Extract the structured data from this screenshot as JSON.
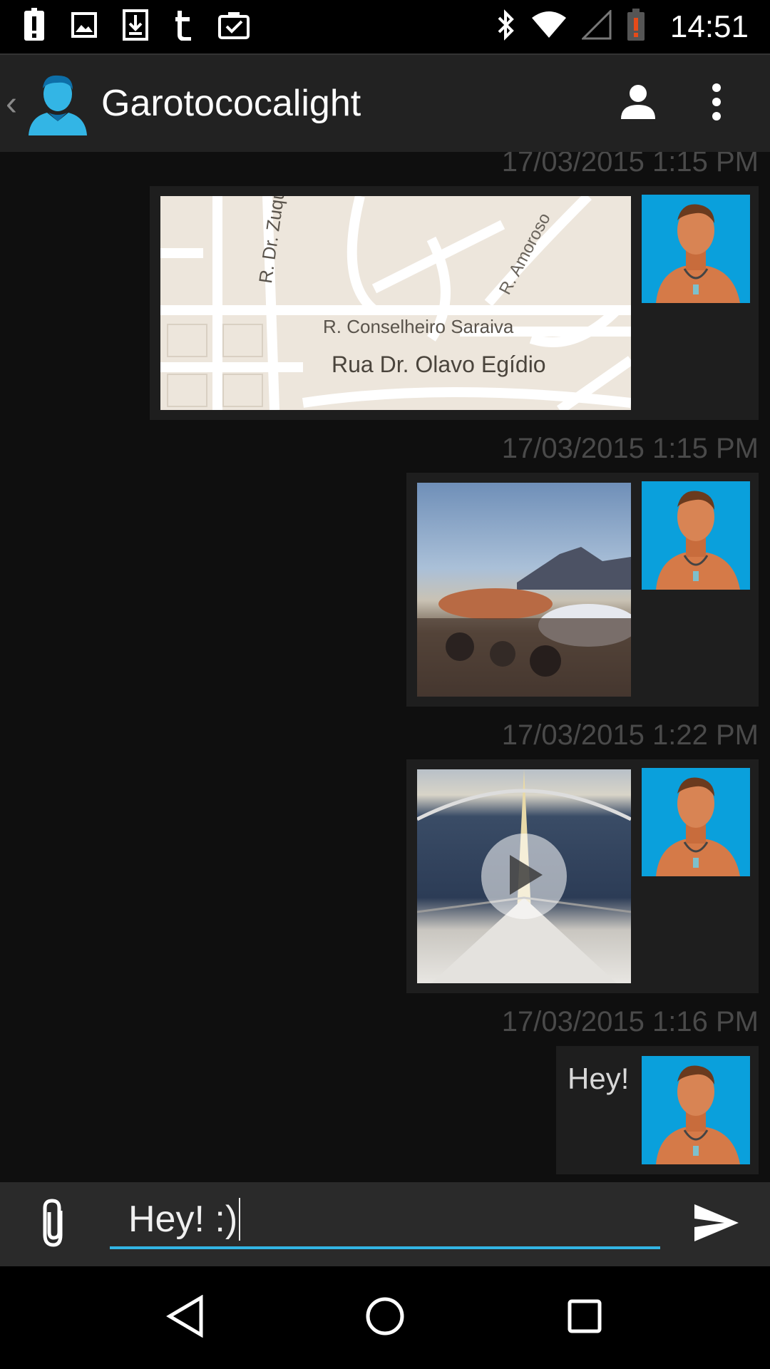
{
  "status_bar": {
    "time": "14:51",
    "left_icons": [
      "alert-icon",
      "image-icon",
      "download-icon",
      "tumblr-icon",
      "clipboard-check-icon"
    ],
    "right_icons": [
      "bluetooth-icon",
      "wifi-icon",
      "cell-signal-icon",
      "battery-alert-icon"
    ]
  },
  "app_bar": {
    "back_symbol": "‹",
    "contact_name": "Garotococalight",
    "actions": [
      "person-icon",
      "overflow-menu-icon"
    ]
  },
  "messages": [
    {
      "timestamp": "17/03/2015 1:15 PM",
      "type": "map",
      "map_labels": [
        "R. Dr. Zuqu",
        "R. Amoroso",
        "R. Conselheiro Saraiva",
        "Rua Dr. Olavo Egídio"
      ]
    },
    {
      "timestamp": "17/03/2015 1:15 PM",
      "type": "photo"
    },
    {
      "timestamp": "17/03/2015 1:22 PM",
      "type": "video"
    },
    {
      "timestamp": "17/03/2015 1:16 PM",
      "type": "text",
      "text": "Hey!"
    }
  ],
  "composer": {
    "value": "Hey! :)"
  },
  "colors": {
    "accent": "#33b5e5",
    "avatar_bg": "#0aa0dc",
    "bubble": "#1e1e1e"
  }
}
